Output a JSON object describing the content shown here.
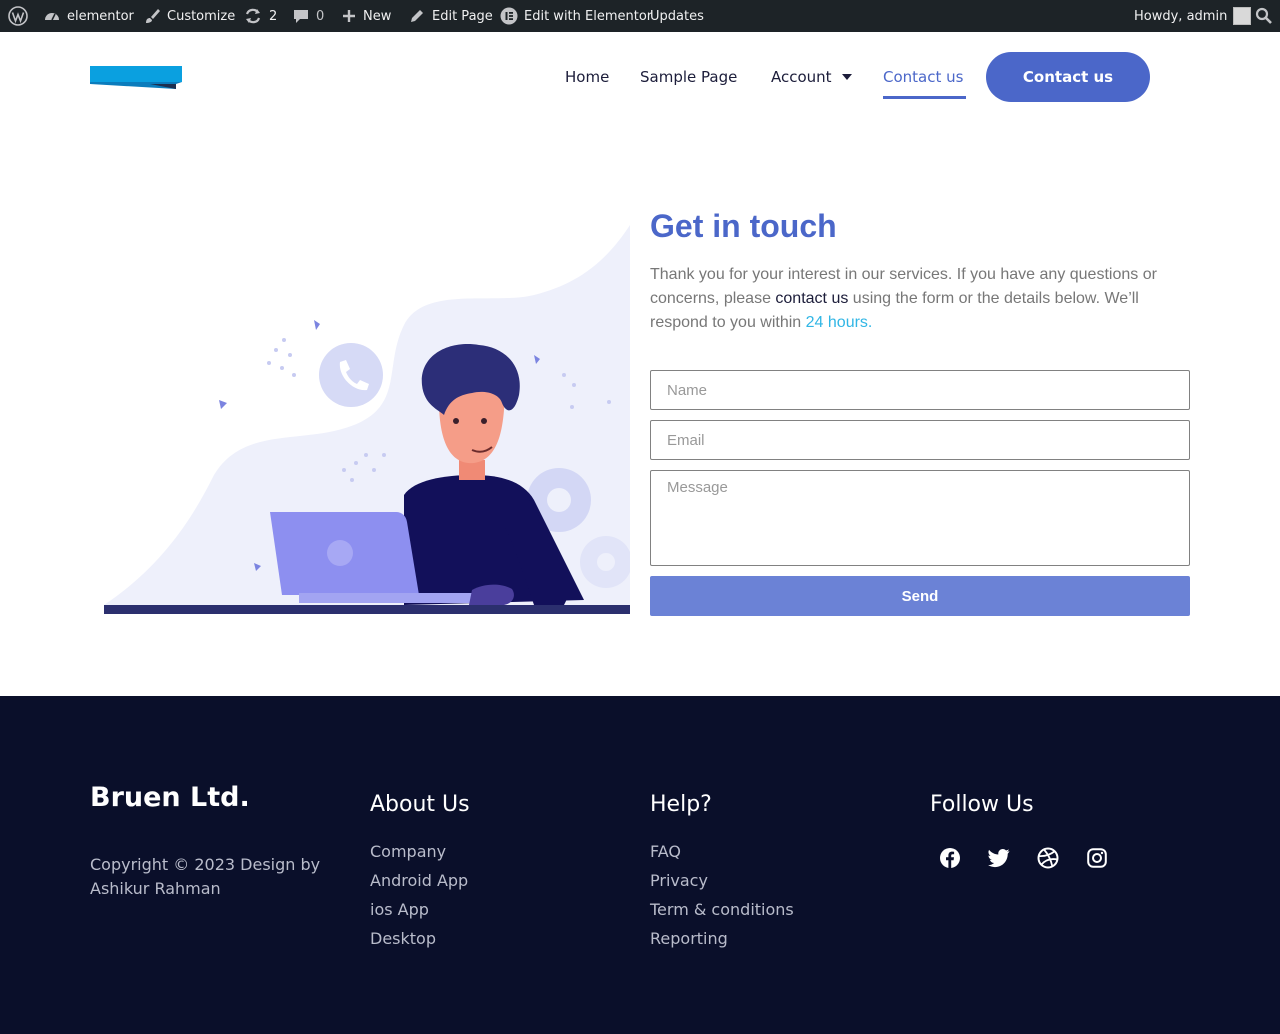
{
  "admin_bar": {
    "site_name": "elementor",
    "customize": "Customize",
    "updates_count": "2",
    "comments_count": "0",
    "new": "New",
    "edit_page": "Edit Page",
    "edit_elementor": "Edit with Elementor",
    "updates": "Updates",
    "howdy": "Howdy, admin"
  },
  "nav": {
    "items": [
      {
        "label": "Home"
      },
      {
        "label": "Sample Page"
      },
      {
        "label": "Account"
      },
      {
        "label": "Contact us"
      }
    ],
    "active": "Contact us",
    "cta_label": "Contact us"
  },
  "contact": {
    "title": "Get in touch",
    "desc_part1": "Thank you for your interest in our services. If you have any questions or concerns, please ",
    "desc_link": "contact us",
    "desc_part2": " using the form or the details below. We’ll respond to you within ",
    "desc_highlight": "24 hours.",
    "name_placeholder": "Name",
    "email_placeholder": "Email",
    "message_placeholder": "Message",
    "send_label": "Send"
  },
  "footer": {
    "brand": "Bruen Ltd.",
    "copyright": "Copyright © 2023 Design by Ashikur Rahman",
    "about": {
      "title": "About Us",
      "links": [
        "Company",
        "Android App",
        "ios App",
        "Desktop"
      ]
    },
    "help": {
      "title": "Help?",
      "links": [
        "FAQ",
        "Privacy",
        "Term & conditions",
        "Reporting"
      ]
    },
    "follow": {
      "title": "Follow Us",
      "icons": [
        "facebook-icon",
        "twitter-icon",
        "dribbble-icon",
        "instagram-icon"
      ]
    }
  },
  "colors": {
    "accent": "#4b67c9",
    "send_button": "#6b82d6",
    "highlight": "#31b6e5",
    "footer_bg": "#0a0f2a",
    "admin_bar_bg": "#1d2327"
  }
}
